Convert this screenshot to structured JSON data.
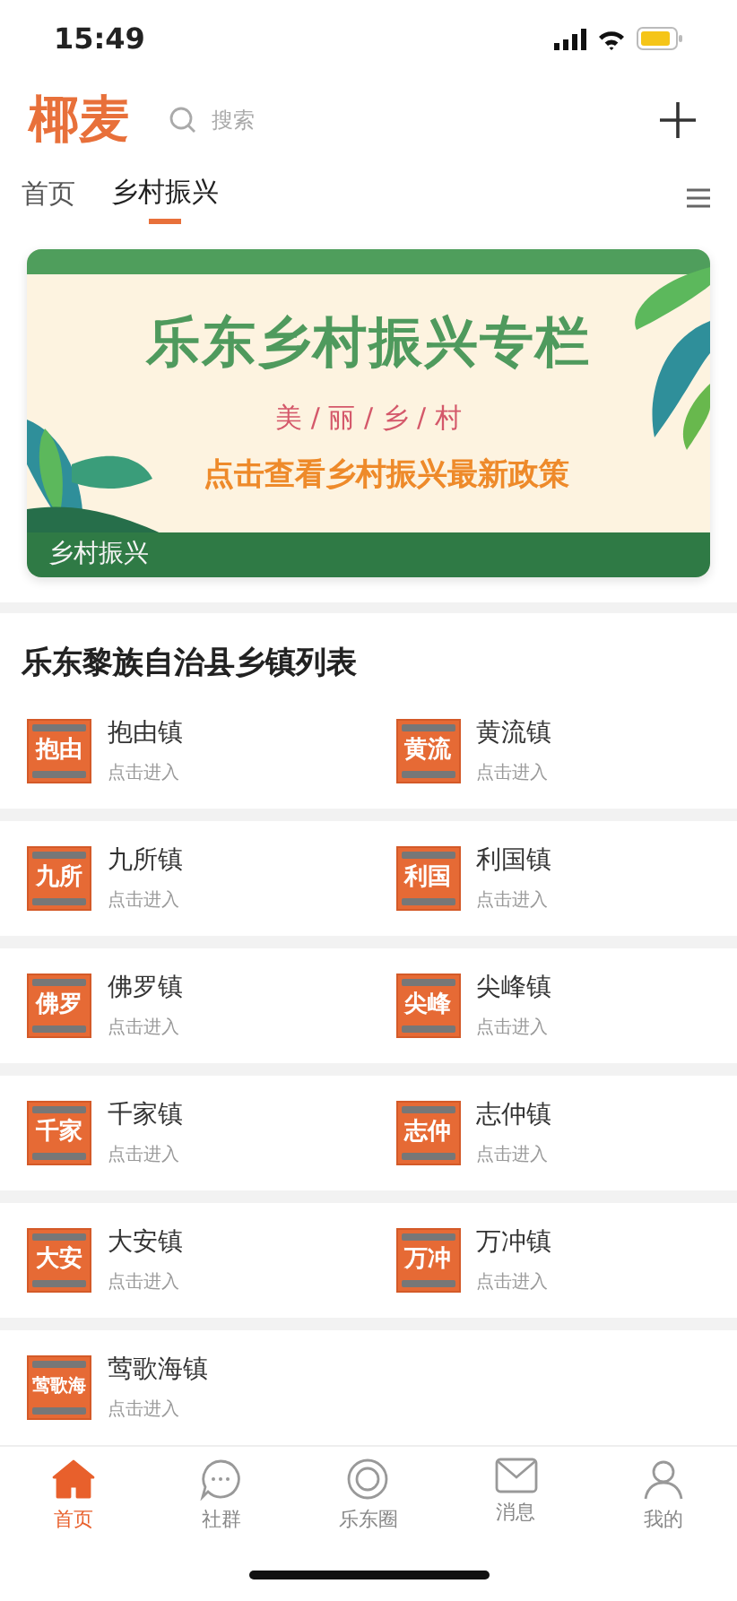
{
  "status_bar": {
    "time": "15:49"
  },
  "header": {
    "logo": "椰麦",
    "search": {
      "placeholder": "搜索"
    }
  },
  "tabs": [
    {
      "label": "首页",
      "selected": false
    },
    {
      "label": "乡村振兴",
      "selected": true
    }
  ],
  "banner": {
    "title": "乐东乡村振兴专栏",
    "subtitle": "美 / 丽 / 乡 / 村",
    "cta": "点击查看乡村振兴最新政策",
    "caption": "乡村振兴"
  },
  "section_title": "乐东黎族自治县乡镇列表",
  "towns": [
    {
      "badge": "抱由",
      "name": "抱由镇",
      "hint": "点击进入"
    },
    {
      "badge": "黄流",
      "name": "黄流镇",
      "hint": "点击进入"
    },
    {
      "badge": "九所",
      "name": "九所镇",
      "hint": "点击进入"
    },
    {
      "badge": "利国",
      "name": "利国镇",
      "hint": "点击进入"
    },
    {
      "badge": "佛罗",
      "name": "佛罗镇",
      "hint": "点击进入"
    },
    {
      "badge": "尖峰",
      "name": "尖峰镇",
      "hint": "点击进入"
    },
    {
      "badge": "千家",
      "name": "千家镇",
      "hint": "点击进入"
    },
    {
      "badge": "志仲",
      "name": "志仲镇",
      "hint": "点击进入"
    },
    {
      "badge": "大安",
      "name": "大安镇",
      "hint": "点击进入"
    },
    {
      "badge": "万冲",
      "name": "万冲镇",
      "hint": "点击进入"
    },
    {
      "badge": "莺歌海",
      "name": "莺歌海镇",
      "hint": "点击进入"
    }
  ],
  "bottom_nav": [
    {
      "kind": "home",
      "label": "首页",
      "selected": true
    },
    {
      "kind": "chat",
      "label": "社群",
      "selected": false
    },
    {
      "kind": "circle",
      "label": "乐东圈",
      "selected": false
    },
    {
      "kind": "mail",
      "label": "消息",
      "selected": false
    },
    {
      "kind": "person",
      "label": "我的",
      "selected": false
    }
  ]
}
